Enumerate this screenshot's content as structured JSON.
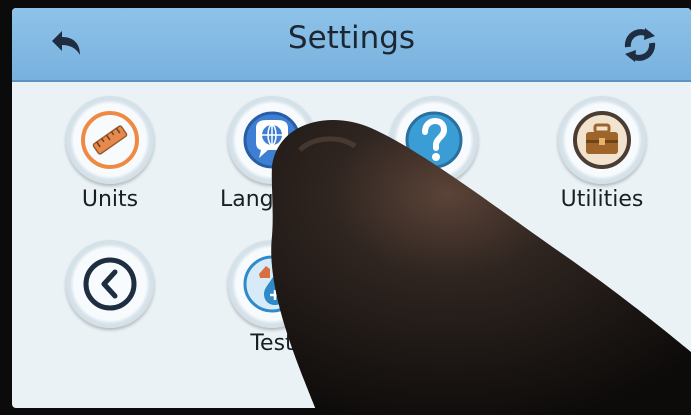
{
  "header": {
    "title": "Settings",
    "back_icon": "back-arrow-icon",
    "refresh_icon": "refresh-icon"
  },
  "tiles": [
    {
      "label": "Units",
      "icon": "ruler-icon",
      "color": "#ef8a43"
    },
    {
      "label": "Lang",
      "icon": "language-globe-icon",
      "color": "#3f7fd3"
    },
    {
      "label": "",
      "icon": "help-question-icon",
      "color": "#3a9dd6"
    },
    {
      "label": "Utilities",
      "icon": "toolbox-icon",
      "color": "#9e642a"
    },
    {
      "label": "",
      "icon": "previous-page-icon",
      "color": "#2a2f35"
    },
    {
      "label": "Test",
      "icon": "test-drop-icon",
      "color": "#2f8ac9"
    }
  ]
}
